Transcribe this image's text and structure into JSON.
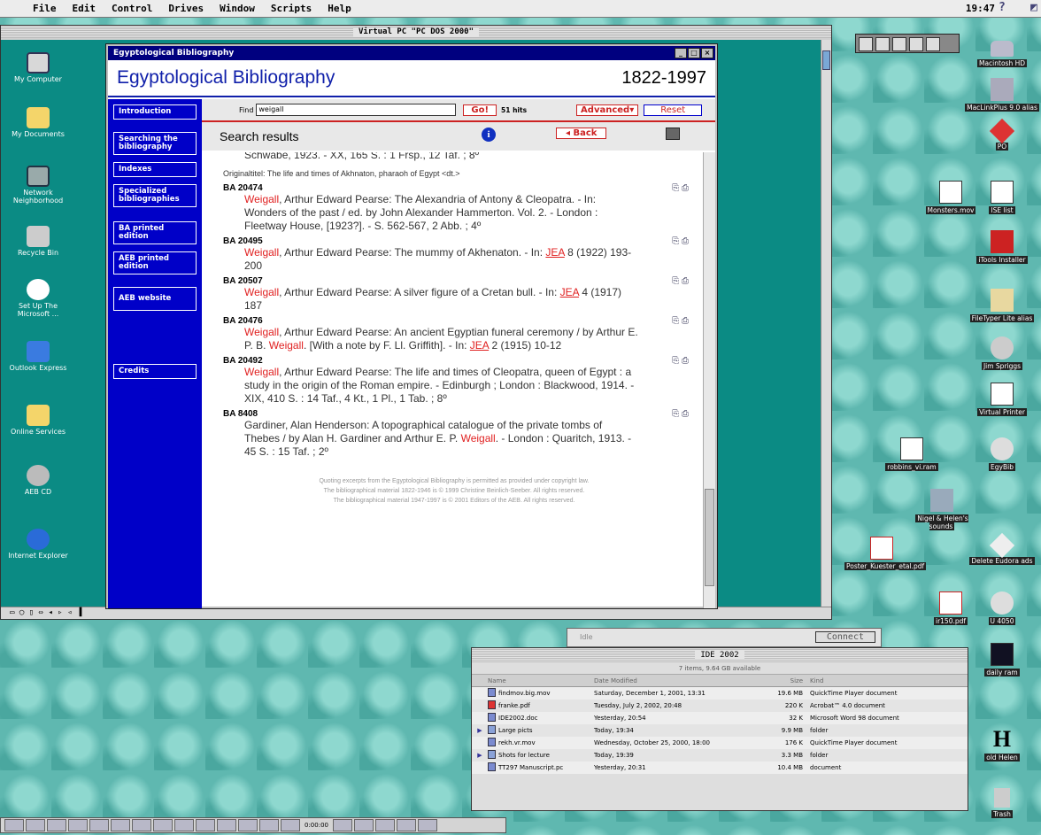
{
  "menubar": {
    "items": [
      "File",
      "Edit",
      "Control",
      "Drives",
      "Window",
      "Scripts",
      "Help"
    ],
    "clock": "19:47"
  },
  "vpc": {
    "title": "Virtual PC \"PC DOS 2000\""
  },
  "windows_desktop": {
    "icons": [
      "My Computer",
      "My Documents",
      "Network Neighborhood",
      "Recycle Bin",
      "Set Up The Microsoft ...",
      "Outlook Express",
      "Online Services",
      "AEB CD",
      "Internet Explorer"
    ]
  },
  "eb": {
    "window_title": "Egyptological Bibliography",
    "title": "Egyptological Bibliography",
    "years": "1822-1997",
    "nav": [
      "Introduction",
      "Searching the bibliography",
      "Indexes",
      "Specialized bibliographies",
      "BA printed edition",
      "AEB printed edition",
      "AEB website",
      "Credits"
    ],
    "find_label": "Find",
    "find_value": "weigall",
    "go": "Go!",
    "hits": "51 hits",
    "advanced": "Advanced▾",
    "reset": "Reset",
    "results_title": "Search results",
    "back": "◂ Back",
    "top_line": "Schwabe, 1923. - XX, 165 S. : 1 Frsp., 12 Taf. ; 8º",
    "original_title": "Originaltitel: The life and times of Akhnaton, pharaoh of Egypt <dt.>",
    "entries": [
      {
        "id": "BA 20474",
        "name": "Weigall",
        "rest": ", Arthur Edward Pearse: The Alexandria of Antony & Cleopatra. - In: Wonders of the past / ed. by John Alexander Hammerton. Vol. 2. - London : Fleetway House, [1923?]. - S. 562-567, 2 Abb. ; 4º"
      },
      {
        "id": "BA 20495",
        "name": "Weigall",
        "rest": ", Arthur Edward Pearse: The mummy of Akhenaton. - In: ",
        "link": "JEA",
        "after": " 8 (1922) 193-200"
      },
      {
        "id": "BA 20507",
        "name": "Weigall",
        "rest": ", Arthur Edward Pearse: A silver figure of a Cretan bull. - In: ",
        "link": "JEA",
        "after": " 4 (1917) 187"
      },
      {
        "id": "BA 20476",
        "name": "Weigall",
        "rest": ", Arthur Edward Pearse: An ancient Egyptian funeral ceremony / by Arthur E. P. B. ",
        "name2": "Weigall",
        "rest2": ". [With a note by F. Ll. Griffith]. - In: ",
        "link": "JEA",
        "after": " 2 (1915) 10-12"
      },
      {
        "id": "BA 20492",
        "name": "Weigall",
        "rest": ", Arthur Edward Pearse: The life and times of Cleopatra, queen of Egypt : a study in the origin of the Roman empire. - Edinburgh ; London : Blackwood, 1914. - XIX, 410 S. : 14 Taf., 4 Kt., 1 Pl., 1 Tab. ; 8º"
      },
      {
        "id": "BA 8408",
        "pre": "Gardiner, Alan Henderson: A topographical catalogue of the private tombs of Thebes / by Alan H. Gardiner and Arthur E. P. ",
        "name": "Weigall",
        "rest": ". - London : Quaritch, 1913. - 45 S. : 15 Taf. ; 2º"
      }
    ],
    "footer": [
      "Quoting excerpts from the Egyptological Bibliography is permitted as provided under copyright law.",
      "The bibliographical material 1822-1946 is © 1999 Christine Beinlich-Seeber. All rights reserved.",
      "The bibliographical material 1947-1997 is © 2001 Editors of the AEB. All rights reserved."
    ]
  },
  "mac_desktop": {
    "icons": [
      "Macintosh HD",
      "MacLinkPlus 9.0 alias",
      "PO",
      "Monsters.mov",
      "ISE list",
      "iTools Installer",
      "FileTyper Lite alias",
      "Jim Spriggs",
      "Virtual Printer",
      "robbins_vi.ram",
      "EgyBib",
      "Nigel & Helen's sounds",
      "Poster_Kuester_etal.pdf",
      "Delete Eudora ads",
      "ir150.pdf",
      "U 4050",
      "daily ram",
      "old Helen",
      "Trash"
    ]
  },
  "connect": {
    "idle": "Idle",
    "button": "Connect"
  },
  "finder": {
    "title": "IDE 2002",
    "info": "7 items, 9.64 GB available",
    "headers": [
      "Name",
      "Date Modified",
      "Size",
      "Kind"
    ],
    "rows": [
      {
        "arrow": "",
        "name": "findmov.big.mov",
        "date": "Saturday, December 1, 2001, 13:31",
        "size": "19.6 MB",
        "kind": "QuickTime Player document"
      },
      {
        "arrow": "",
        "name": "franke.pdf",
        "date": "Tuesday, July 2, 2002, 20:48",
        "size": "220 K",
        "kind": "Acrobat™ 4.0 document"
      },
      {
        "arrow": "",
        "name": "IDE2002.doc",
        "date": "Yesterday, 20:54",
        "size": "32 K",
        "kind": "Microsoft Word 98 document"
      },
      {
        "arrow": "▶",
        "name": "Large picts",
        "date": "Today, 19:34",
        "size": "9.9 MB",
        "kind": "folder"
      },
      {
        "arrow": "",
        "name": "rekh.vr.mov",
        "date": "Wednesday, October 25, 2000, 18:00",
        "size": "176 K",
        "kind": "QuickTime Player document"
      },
      {
        "arrow": "▶",
        "name": "Shots for lecture",
        "date": "Today, 19:39",
        "size": "3.3 MB",
        "kind": "folder"
      },
      {
        "arrow": "",
        "name": "TT297 Manuscript.pc",
        "date": "Yesterday, 20:31",
        "size": "10.4 MB",
        "kind": "document"
      }
    ]
  },
  "strip": {
    "time": "0:00:00"
  }
}
